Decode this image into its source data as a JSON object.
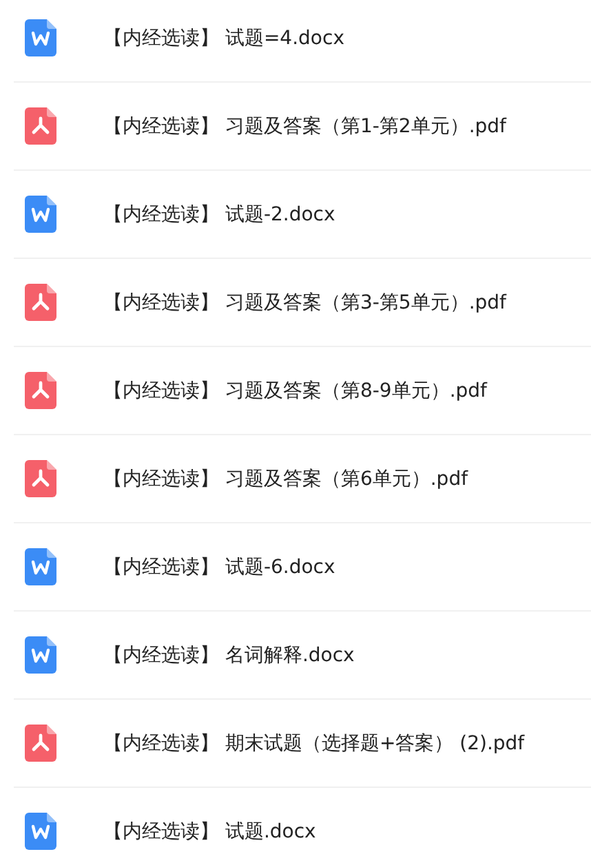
{
  "files": [
    {
      "kind": "word",
      "name": "【内经选读】 试题=4.docx"
    },
    {
      "kind": "pdf",
      "name": "【内经选读】 习题及答案（第1-第2单元）.pdf"
    },
    {
      "kind": "word",
      "name": "【内经选读】 试题-2.docx"
    },
    {
      "kind": "pdf",
      "name": "【内经选读】 习题及答案（第3-第5单元）.pdf"
    },
    {
      "kind": "pdf",
      "name": "【内经选读】 习题及答案（第8-9单元）.pdf"
    },
    {
      "kind": "pdf",
      "name": "【内经选读】 习题及答案（第6单元）.pdf"
    },
    {
      "kind": "word",
      "name": "【内经选读】 试题-6.docx"
    },
    {
      "kind": "word",
      "name": "【内经选读】 名词解释.docx"
    },
    {
      "kind": "pdf",
      "name": "【内经选读】 期末试题（选择题+答案） (2).pdf"
    },
    {
      "kind": "word",
      "name": "【内经选读】 试题.docx"
    }
  ]
}
